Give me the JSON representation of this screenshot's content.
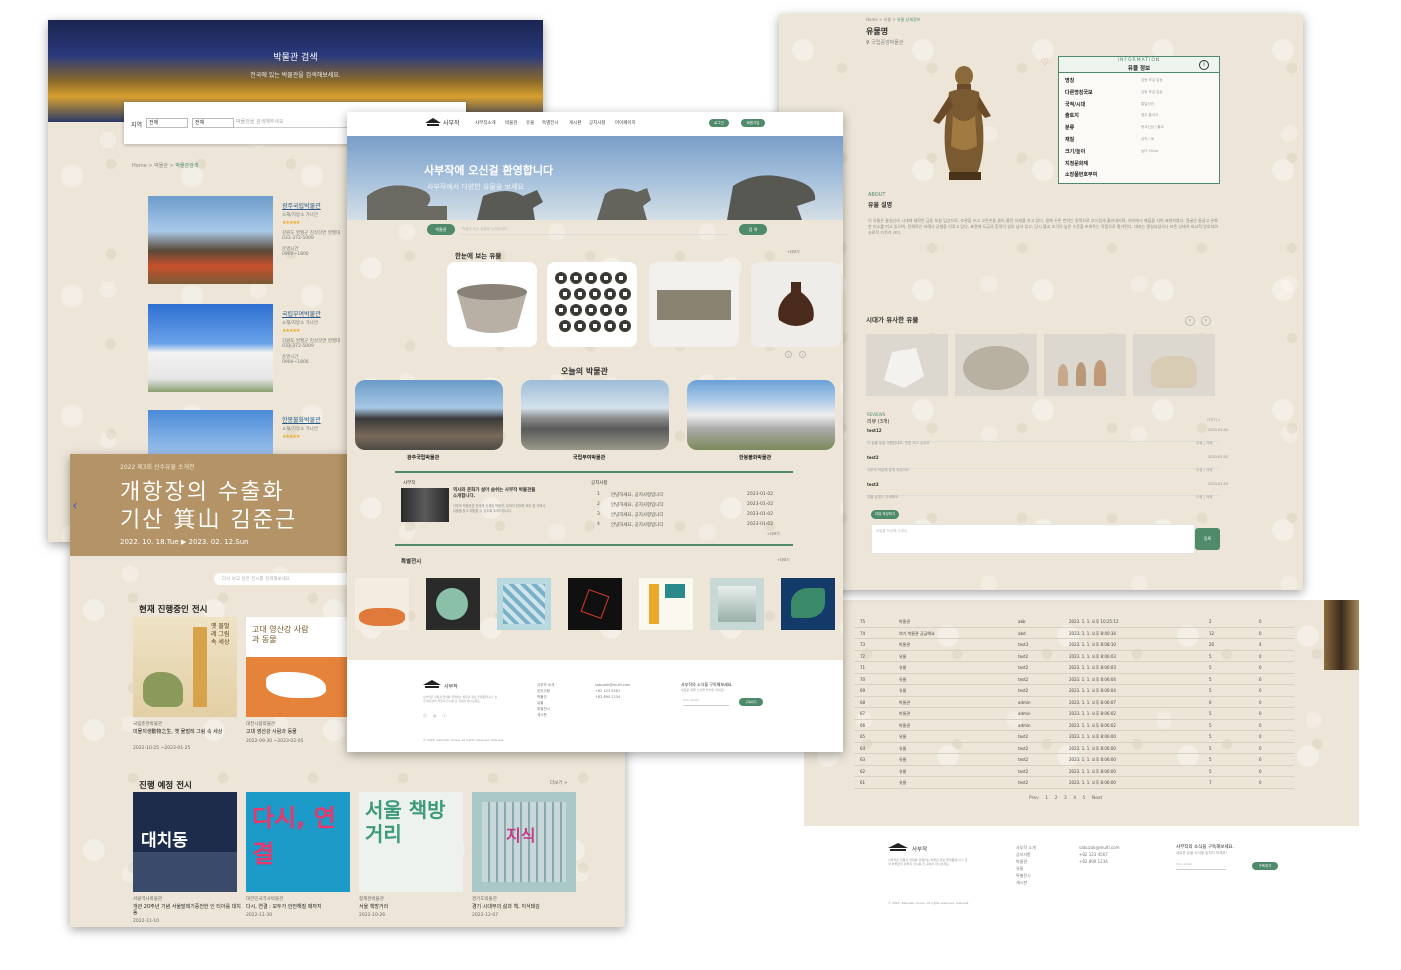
{
  "search_page": {
    "hero_title": "박물관 검색",
    "hero_sub": "전국에 있는 박물관을 검색해보세요.",
    "region_label": "지역",
    "select_1": "전체",
    "select_2": "전체",
    "search_placeholder": "박물관을 검색해주세요",
    "breadcrumb": [
      "Home",
      "박물관",
      "박물관검색"
    ],
    "museums": [
      {
        "name": "광주국립박물관",
        "type": "소재/지방소 가나안",
        "stars": "★★★★★",
        "addr": "강원도 영월군 김삿갓면 영월대",
        "tel": "033-372-5009",
        "hours_label": "운영시간",
        "hours": "0900~1800"
      },
      {
        "name": "국립부여박물관",
        "type": "소재/지방소 가나안",
        "stars": "★★★★★",
        "addr": "강원도 영월군 김삿갓면 영월대",
        "tel": "033-372-5009",
        "hours_label": "운영시간",
        "hours": "0900~1800"
      },
      {
        "name": "한봉불화박물관",
        "type": "소재/지방소 가나안",
        "stars": "★★★★★"
      }
    ]
  },
  "exhibition_page": {
    "banner_small": "2022 제3회 신수유물 소개전",
    "banner_line1": "개항장의 수출화",
    "banner_line2": "기산 箕山 김준근",
    "banner_date": "2022. 10. 18.Tue  ▶  2023. 02. 12.Sun",
    "search_placeholder": "다시 보고 싶은 전시를 검색해보세요",
    "current_title": "현재 진행중인 전시",
    "current": [
      {
        "museum": "국립춘천박물관",
        "title": "미물지생動物之生, 옛 물벌레 그림 속 세상",
        "dates": "2022-10-25 ~2023-01-25",
        "poster_text": "옛 물벌레 그림 속 세상"
      },
      {
        "museum": "대전시립박물관",
        "title": "고대 영산강 사람과 동물",
        "dates": "2022-09-30 ~2023-02-05",
        "poster_text": "고대 영산강 사람과 동물"
      }
    ],
    "upcoming_title": "진행 예정 전시",
    "more": "더보기 >",
    "upcoming": [
      {
        "museum": "서울역사박물관",
        "title": "개관 20주년 기념 서울발레기증전한 인 티아를 대치동",
        "dates": "2022-11-10",
        "poster_text": "대치동"
      },
      {
        "museum": "대한민국역사박물관",
        "title": "다시, 연결 : 모두가 안전해질 때까지",
        "dates": "2022-11-30",
        "poster_text": "다시, 연결"
      },
      {
        "museum": "청계천박물관",
        "title": "서울 책방거리",
        "dates": "2022-10-26",
        "poster_text": "서울 책방거리"
      },
      {
        "museum": "경기도박물관",
        "title": "경기 시대부의 삶과 책, 지식돼김",
        "dates": "2022-12-07",
        "poster_text": "지식"
      }
    ]
  },
  "home_page": {
    "logo": "사부작",
    "nav": [
      "사부작소개",
      "박물관",
      "유물",
      "특별전시",
      "게시판",
      "공지사항",
      "마이페이지"
    ],
    "login": "로그인",
    "signup": "회원가입",
    "hero_title": "사부작에 오신걸 환영합니다",
    "hero_sub": "사부작에서 다양한 유물을 보세요",
    "search_chip": "박물관",
    "search_placeholder": "박물관 또는 유물을 입력하세요",
    "search_btn": "검 색",
    "artifacts_title": "한눈에 보는 유물",
    "more": "+더보기",
    "today_title": "오늘의 박물관",
    "today": [
      "광주국립박물관",
      "국립부여박물관",
      "한봉불화박물관"
    ],
    "about_label": "사부작",
    "about_text": "역사와 문화가 살아 숨쉬는 사부작 박물관을 소개합니다.",
    "about_body": "사부작 박물관은 전국에 산재된 박물관, 유적지 정보를 모아 한 곳에서 유물을 찾고 체험할 수 있도록 도와드립니다.",
    "notice_title": "공지사항",
    "notices": [
      {
        "no": "1",
        "title": "안녕하세요, 공지사항입니다",
        "date": "2023-01-02"
      },
      {
        "no": "2",
        "title": "안녕하세요, 공지사항입니다",
        "date": "2023-01-02"
      },
      {
        "no": "3",
        "title": "안녕하세요, 공지사항입니다",
        "date": "2023-01-02"
      },
      {
        "no": "4",
        "title": "안녕하세요, 공지사항입니다",
        "date": "2023-01-02"
      }
    ],
    "special_title": "특별전시",
    "special_more": "+더보기",
    "footer": {
      "logo": "사부작",
      "desc": "사부작은 전통과 현대를 연결하는 박물관 정보 플랫폼입니다. 전국 박물관의 유물과 전시를 한 곳에서 만나보세요.",
      "links": [
        "사부작 소개",
        "공지사항",
        "박물관",
        "유물",
        "특별전시",
        "게시판"
      ],
      "email": "sabuzak@multi.com",
      "tel1": "+82 123 4567",
      "tel2": "+82 890 1234",
      "subscribe_title": "사부작의 소식을 구독해보세요.",
      "subscribe_sub": "새로운 유물 소식을 놓치지 마세요!",
      "email_placeholder": "Your email",
      "subscribe_btn": "구독하기",
      "copyright": "© 2022, Sabuzak, Korea. All rights reserved. Sabuzak"
    }
  },
  "detail_page": {
    "breadcrumb": [
      "Home",
      "유물",
      "유물 상세정보"
    ],
    "title": "유물명",
    "museum": "국립중앙박물관",
    "info_en": "INFORMATION",
    "info_ko": "유물 정보",
    "info_rows": [
      {
        "k": "명칭",
        "v": "금동 보살 입상"
      },
      {
        "k": "다른명칭국보",
        "v": "금동 보살 입상"
      },
      {
        "k": "국적/시대",
        "v": "통일신라"
      },
      {
        "k": "출토지",
        "v": "경주 불국사"
      },
      {
        "k": "분류",
        "v": "종교신앙 / 불교"
      },
      {
        "k": "재질",
        "v": "금속 / 동"
      },
      {
        "k": "크기/높이",
        "v": "높이 45cm"
      },
      {
        "k": "지정문화재",
        "v": ""
      },
      {
        "k": "소장품번호부여",
        "v": ""
      }
    ],
    "about_en": "ABOUT",
    "about_ko": "유물 설명",
    "about_text": "이 유물은 통일신라 시대에 제작된 금동 보살 입상으로, 보관을 쓰고 오른손을 들어 올린 자세를 하고 있다. 몸에 두른 천의는 양쪽으로 부드럽게 흘러내리며, 허리에서 매듭을 지어 표현하였다. 얼굴은 둥글고 온화한 미소를 띠고 있으며, 전체적인 비례가 균형을 이루고 있다. 표면에 도금의 흔적이 일부 남아 있고, 당시 불교 조각의 높은 수준을 보여주는 작품으로 평가된다. 대좌는 결실되었으나 보존 상태가 비교적 양호하여 사료적 가치가 크다.",
    "similar_title": "시대가 유사한 유물",
    "reviews_en": "REVIEWS",
    "reviews_ko": "리뷰 (3개)",
    "reviews_more": "더보기 >",
    "reviews": [
      {
        "user": "test12",
        "text": "이 유물 정말 아름답네요. 직접 보고 싶어요",
        "date": "2023.01.02",
        "act": "수정 | 삭제"
      },
      {
        "user": "test2",
        "text": "사부작 덕분에 알게 되었어요",
        "date": "2023.01.03",
        "act": "수정 | 삭제"
      },
      {
        "user": "test3",
        "text": "유물 설명이 자세해요",
        "date": "2023.01.03",
        "act": "수정 | 삭제"
      }
    ],
    "write_btn": "리뷰 작성하기",
    "submit_btn": "등록",
    "textarea_hint": "리뷰를 작성해 주세요"
  },
  "table_page": {
    "rows": [
      {
        "no": "75",
        "cat": "박물관",
        "user": "abb",
        "date": "2023. 1. 1. 오후 10:25:12",
        "views": "2",
        "likes": "0"
      },
      {
        "no": "74",
        "cat": "여기 박물관 궁금해요",
        "user": "abd",
        "date": "2023. 1. 1. 오후 8:40:34",
        "views": "12",
        "likes": "0"
      },
      {
        "no": "73",
        "cat": "박물관",
        "user": "test3",
        "date": "2023. 1. 1. 오후 8:08:10",
        "views": "20",
        "likes": "4"
      },
      {
        "no": "72",
        "cat": "유물",
        "user": "test2",
        "date": "2023. 1. 1. 오후 8:06:03",
        "views": "5",
        "likes": "0"
      },
      {
        "no": "71",
        "cat": "유물",
        "user": "test2",
        "date": "2023. 1. 1. 오후 8:06:03",
        "views": "5",
        "likes": "0"
      },
      {
        "no": "70",
        "cat": "유물",
        "user": "test2",
        "date": "2023. 1. 1. 오후 8:06:04",
        "views": "5",
        "likes": "0"
      },
      {
        "no": "69",
        "cat": "유물",
        "user": "test2",
        "date": "2023. 1. 1. 오후 8:06:04",
        "views": "5",
        "likes": "0"
      },
      {
        "no": "68",
        "cat": "박물관",
        "user": "admin",
        "date": "2023. 1. 1. 오후 8:06:07",
        "views": "6",
        "likes": "0"
      },
      {
        "no": "67",
        "cat": "박물관",
        "user": "admin",
        "date": "2023. 1. 1. 오후 8:06:02",
        "views": "5",
        "likes": "0"
      },
      {
        "no": "66",
        "cat": "박물관",
        "user": "admin",
        "date": "2023. 1. 1. 오후 8:06:02",
        "views": "5",
        "likes": "0"
      },
      {
        "no": "65",
        "cat": "유물",
        "user": "test2",
        "date": "2023. 1. 1. 오후 8:06:00",
        "views": "5",
        "likes": "0"
      },
      {
        "no": "64",
        "cat": "유물",
        "user": "test2",
        "date": "2023. 1. 1. 오후 8:06:00",
        "views": "5",
        "likes": "0"
      },
      {
        "no": "63",
        "cat": "유물",
        "user": "test2",
        "date": "2023. 1. 1. 오후 8:06:00",
        "views": "5",
        "likes": "0"
      },
      {
        "no": "62",
        "cat": "유물",
        "user": "test2",
        "date": "2023. 1. 1. 오후 8:06:00",
        "views": "5",
        "likes": "0"
      },
      {
        "no": "61",
        "cat": "유물",
        "user": "test2",
        "date": "2023. 1. 1. 오후 8:06:00",
        "views": "7",
        "likes": "0"
      }
    ],
    "pager": [
      "Prev",
      "1",
      "2",
      "3",
      "4",
      "5",
      "Next"
    ]
  }
}
